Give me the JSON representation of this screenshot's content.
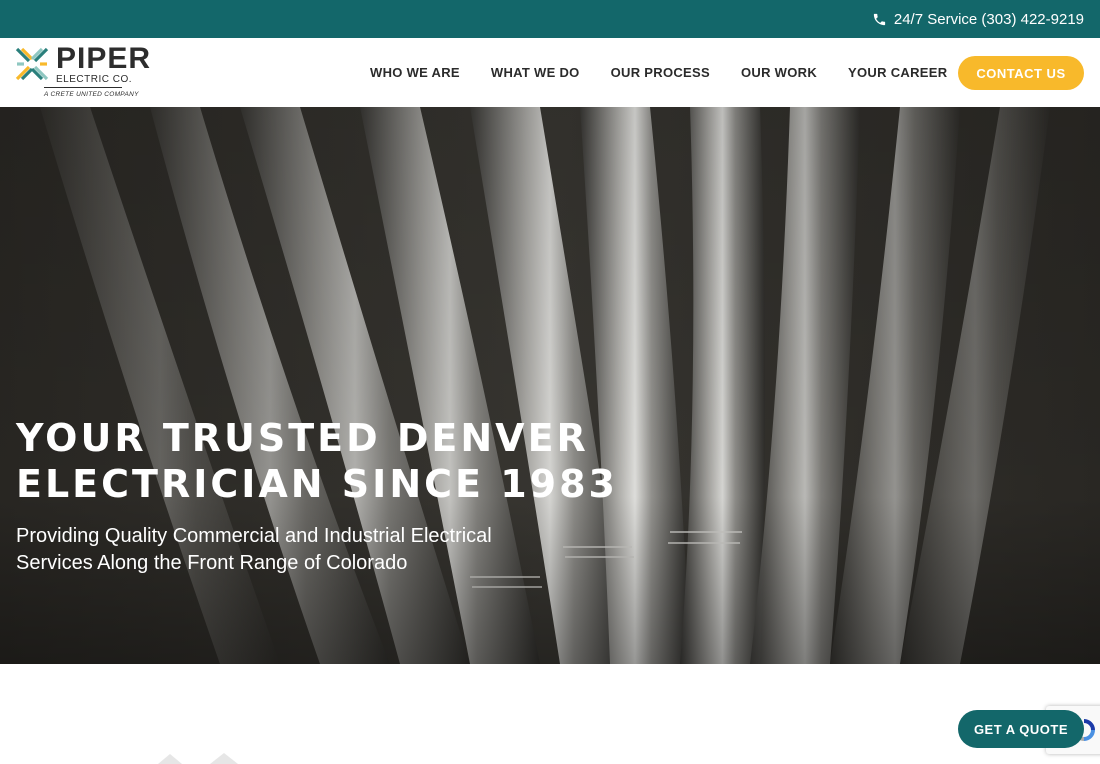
{
  "topbar": {
    "service_text": "24/7 Service (303) 422-9219",
    "phone_icon": "phone-icon",
    "bg_color": "#13676a"
  },
  "logo": {
    "name": "PIPER",
    "sub": "ELECTRIC CO.",
    "tagline": "A CRETE UNITED COMPANY",
    "mark_icon": "piper-logo-mark-icon"
  },
  "nav": {
    "items": [
      {
        "label": "WHO WE ARE"
      },
      {
        "label": "WHAT WE DO"
      },
      {
        "label": "OUR PROCESS"
      },
      {
        "label": "OUR WORK"
      },
      {
        "label": "YOUR CAREER"
      }
    ],
    "contact_label": "CONTACT US",
    "contact_color": "#f8b92b"
  },
  "hero": {
    "title_line1": "YOUR TRUSTED DENVER",
    "title_line2": "ELECTRICIAN SINCE 1983",
    "subtitle": "Providing Quality Commercial and Industrial Electrical Services Along the Front Range of Colorado"
  },
  "quote": {
    "label": "GET A QUOTE",
    "color": "#13676a"
  },
  "recaptcha": {
    "icon": "recaptcha-icon"
  }
}
